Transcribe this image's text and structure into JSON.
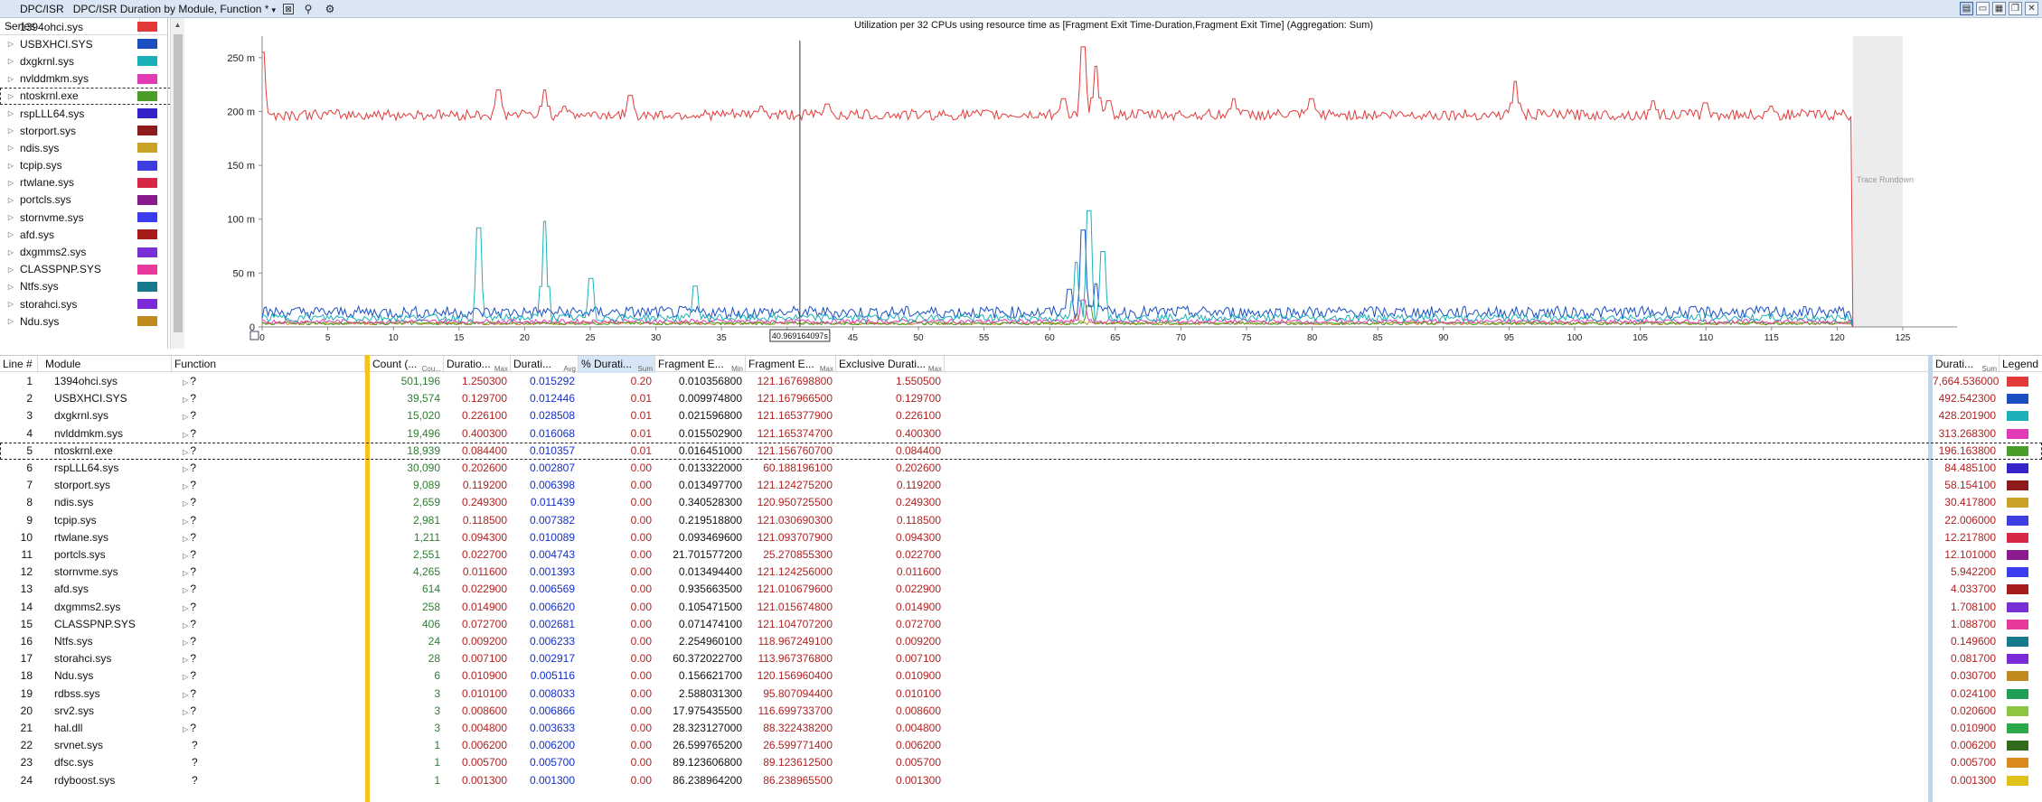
{
  "window": {
    "title_group": "DPC/ISR",
    "title_view": "DPC/ISR Duration by Module, Function *",
    "caret": "▾"
  },
  "series_panel": {
    "header": "Series",
    "items": [
      {
        "name": "1394ohci.sys",
        "color": "#e23a3a"
      },
      {
        "name": "USBXHCI.SYS",
        "color": "#1a4fc2"
      },
      {
        "name": "dxgkrnl.sys",
        "color": "#1bb0b8"
      },
      {
        "name": "nvlddmkm.sys",
        "color": "#e03bb5"
      },
      {
        "name": "ntoskrnl.exe",
        "color": "#4a9d26"
      },
      {
        "name": "rspLLL64.sys",
        "color": "#3224c8"
      },
      {
        "name": "storport.sys",
        "color": "#8e1a1a"
      },
      {
        "name": "ndis.sys",
        "color": "#c9a127"
      },
      {
        "name": "tcpip.sys",
        "color": "#3d3de0"
      },
      {
        "name": "rtwlane.sys",
        "color": "#d62745"
      },
      {
        "name": "portcls.sys",
        "color": "#8b1a8e"
      },
      {
        "name": "stornvme.sys",
        "color": "#3b3bf0"
      },
      {
        "name": "afd.sys",
        "color": "#a81b1b"
      },
      {
        "name": "dxgmms2.sys",
        "color": "#7a2fd6"
      },
      {
        "name": "CLASSPNP.SYS",
        "color": "#e8399c"
      },
      {
        "name": "Ntfs.sys",
        "color": "#147a8c"
      },
      {
        "name": "storahci.sys",
        "color": "#7b29d9"
      },
      {
        "name": "Ndu.sys",
        "color": "#c08a1e"
      }
    ]
  },
  "chart": {
    "title": "Utilization per 32 CPUs using resource time as [Fragment Exit Time-Duration,Fragment Exit Time] (Aggregation: Sum)",
    "cursor_label": "40.969164097s",
    "rundown_label": "Trace Rundown"
  },
  "chart_data": {
    "type": "line",
    "x_ticks": [
      "0",
      "5",
      "10",
      "15",
      "20",
      "25",
      "30",
      "35",
      "40",
      "45",
      "50",
      "55",
      "60",
      "65",
      "70",
      "75",
      "80",
      "85",
      "90",
      "95",
      "100",
      "105",
      "110",
      "115",
      "120",
      "125"
    ],
    "y_ticks": [
      "0",
      "50 m",
      "100 m",
      "150 m",
      "200 m",
      "250 m"
    ],
    "xlim": [
      0,
      125
    ],
    "ylim": [
      0,
      0.27
    ],
    "cursor_x": 40.969,
    "rundown_start_x": 121.2,
    "series": [
      {
        "name": "1394ohci.sys",
        "color": "#e23a3a",
        "baseline": 0.197,
        "spikes": [
          [
            0,
            0.255
          ],
          [
            18,
            0.22
          ],
          [
            21.5,
            0.22
          ],
          [
            23,
            0.205
          ],
          [
            28,
            0.215
          ],
          [
            38,
            0.205
          ],
          [
            43,
            0.207
          ],
          [
            61,
            0.212
          ],
          [
            62.5,
            0.26
          ],
          [
            63.5,
            0.242
          ],
          [
            64.5,
            0.21
          ],
          [
            74,
            0.212
          ],
          [
            80,
            0.212
          ],
          [
            95.5,
            0.228
          ],
          [
            106,
            0.21
          ],
          [
            110,
            0.208
          ],
          [
            115,
            0.205
          ]
        ]
      },
      {
        "name": "dxgkrnl.sys",
        "color": "#1bb0b8",
        "baseline": 0.005,
        "spikes": [
          [
            16.5,
            0.092
          ],
          [
            21.5,
            0.098
          ],
          [
            25,
            0.045
          ],
          [
            33,
            0.038
          ],
          [
            62,
            0.06
          ],
          [
            63,
            0.108
          ],
          [
            64,
            0.07
          ]
        ]
      },
      {
        "name": "USBXHCI.SYS",
        "color": "#1a4fc2",
        "baseline": 0.008,
        "spikes": [
          [
            61.5,
            0.035
          ],
          [
            62.5,
            0.09
          ],
          [
            63.5,
            0.04
          ]
        ]
      },
      {
        "name": "nvlddmkm.sys",
        "color": "#e03bb5",
        "baseline": 0.003,
        "spikes": [
          [
            62.5,
            0.025
          ]
        ]
      },
      {
        "name": "ntoskrnl.exe",
        "color": "#4a9d26",
        "baseline": 0.002,
        "spikes": [
          [
            63,
            0.02
          ]
        ]
      },
      {
        "name": "Ndu.sys",
        "color": "#c08a1e",
        "baseline": 0.002,
        "spikes": [
          [
            62,
            0.012
          ]
        ]
      }
    ]
  },
  "table": {
    "headers": {
      "line": "Line #",
      "module": "Module",
      "function": "Function",
      "count": "Count (...",
      "count_agg": "Cou...",
      "dur_max": "Duratio...",
      "dur_max_agg": "Max",
      "dur_avg": "Durati...",
      "dur_avg_agg": "Avg",
      "pct": "% Durati...",
      "pct_agg": "Sum",
      "fe_min": "Fragment E...",
      "fe_min_agg": "Min",
      "fe_max": "Fragment E...",
      "fe_max_agg": "Max",
      "excl": "Exclusive Durati...",
      "excl_agg": "Max",
      "dur_sum": "Durati...",
      "dur_sum_agg": "Sum",
      "legend": "Legend"
    },
    "rows": [
      {
        "line": "1",
        "module": "1394ohci.sys",
        "func": "?",
        "count": "501,196",
        "dmax": "1.250300",
        "davg": "0.015292",
        "pct": "0.20",
        "femin": "0.010356800",
        "femax": "121.167698800",
        "excl": "1.550500",
        "dsum": "7,664.536000",
        "color": "#e23a3a"
      },
      {
        "line": "2",
        "module": "USBXHCI.SYS",
        "func": "?",
        "count": "39,574",
        "dmax": "0.129700",
        "davg": "0.012446",
        "pct": "0.01",
        "femin": "0.009974800",
        "femax": "121.167966500",
        "excl": "0.129700",
        "dsum": "492.542300",
        "color": "#1a4fc2"
      },
      {
        "line": "3",
        "module": "dxgkrnl.sys",
        "func": "?",
        "count": "15,020",
        "dmax": "0.226100",
        "davg": "0.028508",
        "pct": "0.01",
        "femin": "0.021596800",
        "femax": "121.165377900",
        "excl": "0.226100",
        "dsum": "428.201900",
        "color": "#1bb0b8"
      },
      {
        "line": "4",
        "module": "nvlddmkm.sys",
        "func": "?",
        "count": "19,496",
        "dmax": "0.400300",
        "davg": "0.016068",
        "pct": "0.01",
        "femin": "0.015502900",
        "femax": "121.165374700",
        "excl": "0.400300",
        "dsum": "313.268300",
        "color": "#e03bb5"
      },
      {
        "line": "5",
        "module": "ntoskrnl.exe",
        "func": "?",
        "count": "18,939",
        "dmax": "0.084400",
        "davg": "0.010357",
        "pct": "0.01",
        "femin": "0.016451000",
        "femax": "121.156760700",
        "excl": "0.084400",
        "dsum": "196.163800",
        "color": "#4a9d26"
      },
      {
        "line": "6",
        "module": "rspLLL64.sys",
        "func": "?",
        "count": "30,090",
        "dmax": "0.202600",
        "davg": "0.002807",
        "pct": "0.00",
        "femin": "0.013322000",
        "femax": "60.188196100",
        "excl": "0.202600",
        "dsum": "84.485100",
        "color": "#3224c8"
      },
      {
        "line": "7",
        "module": "storport.sys",
        "func": "?",
        "count": "9,089",
        "dmax": "0.119200",
        "davg": "0.006398",
        "pct": "0.00",
        "femin": "0.013497700",
        "femax": "121.124275200",
        "excl": "0.119200",
        "dsum": "58.154100",
        "color": "#8e1a1a"
      },
      {
        "line": "8",
        "module": "ndis.sys",
        "func": "?",
        "count": "2,659",
        "dmax": "0.249300",
        "davg": "0.011439",
        "pct": "0.00",
        "femin": "0.340528300",
        "femax": "120.950725500",
        "excl": "0.249300",
        "dsum": "30.417800",
        "color": "#c9a127"
      },
      {
        "line": "9",
        "module": "tcpip.sys",
        "func": "?",
        "count": "2,981",
        "dmax": "0.118500",
        "davg": "0.007382",
        "pct": "0.00",
        "femin": "0.219518800",
        "femax": "121.030690300",
        "excl": "0.118500",
        "dsum": "22.006000",
        "color": "#3d3de0"
      },
      {
        "line": "10",
        "module": "rtwlane.sys",
        "func": "?",
        "count": "1,211",
        "dmax": "0.094300",
        "davg": "0.010089",
        "pct": "0.00",
        "femin": "0.093469600",
        "femax": "121.093707900",
        "excl": "0.094300",
        "dsum": "12.217800",
        "color": "#d62745"
      },
      {
        "line": "11",
        "module": "portcls.sys",
        "func": "?",
        "count": "2,551",
        "dmax": "0.022700",
        "davg": "0.004743",
        "pct": "0.00",
        "femin": "21.701577200",
        "femax": "25.270855300",
        "excl": "0.022700",
        "dsum": "12.101000",
        "color": "#8b1a8e"
      },
      {
        "line": "12",
        "module": "stornvme.sys",
        "func": "?",
        "count": "4,265",
        "dmax": "0.011600",
        "davg": "0.001393",
        "pct": "0.00",
        "femin": "0.013494400",
        "femax": "121.124256000",
        "excl": "0.011600",
        "dsum": "5.942200",
        "color": "#3b3bf0"
      },
      {
        "line": "13",
        "module": "afd.sys",
        "func": "?",
        "count": "614",
        "dmax": "0.022900",
        "davg": "0.006569",
        "pct": "0.00",
        "femin": "0.935663500",
        "femax": "121.010679600",
        "excl": "0.022900",
        "dsum": "4.033700",
        "color": "#a81b1b"
      },
      {
        "line": "14",
        "module": "dxgmms2.sys",
        "func": "?",
        "count": "258",
        "dmax": "0.014900",
        "davg": "0.006620",
        "pct": "0.00",
        "femin": "0.105471500",
        "femax": "121.015674800",
        "excl": "0.014900",
        "dsum": "1.708100",
        "color": "#7a2fd6"
      },
      {
        "line": "15",
        "module": "CLASSPNP.SYS",
        "func": "?",
        "count": "406",
        "dmax": "0.072700",
        "davg": "0.002681",
        "pct": "0.00",
        "femin": "0.071474100",
        "femax": "121.104707200",
        "excl": "0.072700",
        "dsum": "1.088700",
        "color": "#e8399c"
      },
      {
        "line": "16",
        "module": "Ntfs.sys",
        "func": "?",
        "count": "24",
        "dmax": "0.009200",
        "davg": "0.006233",
        "pct": "0.00",
        "femin": "2.254960100",
        "femax": "118.967249100",
        "excl": "0.009200",
        "dsum": "0.149600",
        "color": "#147a8c"
      },
      {
        "line": "17",
        "module": "storahci.sys",
        "func": "?",
        "count": "28",
        "dmax": "0.007100",
        "davg": "0.002917",
        "pct": "0.00",
        "femin": "60.372022700",
        "femax": "113.967376800",
        "excl": "0.007100",
        "dsum": "0.081700",
        "color": "#7b29d9"
      },
      {
        "line": "18",
        "module": "Ndu.sys",
        "func": "?",
        "count": "6",
        "dmax": "0.010900",
        "davg": "0.005116",
        "pct": "0.00",
        "femin": "0.156621700",
        "femax": "120.156960400",
        "excl": "0.010900",
        "dsum": "0.030700",
        "color": "#c08a1e"
      },
      {
        "line": "19",
        "module": "rdbss.sys",
        "func": "?",
        "count": "3",
        "dmax": "0.010100",
        "davg": "0.008033",
        "pct": "0.00",
        "femin": "2.588031300",
        "femax": "95.807094400",
        "excl": "0.010100",
        "dsum": "0.024100",
        "color": "#1f9e58"
      },
      {
        "line": "20",
        "module": "srv2.sys",
        "func": "?",
        "count": "3",
        "dmax": "0.008600",
        "davg": "0.006866",
        "pct": "0.00",
        "femin": "17.975435500",
        "femax": "116.699733700",
        "excl": "0.008600",
        "dsum": "0.020600",
        "color": "#8cc63f"
      },
      {
        "line": "21",
        "module": "hal.dll",
        "func": "?",
        "count": "3",
        "dmax": "0.004800",
        "davg": "0.003633",
        "pct": "0.00",
        "femin": "28.323127000",
        "femax": "88.322438200",
        "excl": "0.004800",
        "dsum": "0.010900",
        "color": "#2aa84a"
      },
      {
        "line": "22",
        "module": "srvnet.sys",
        "func": "?",
        "count": "1",
        "dmax": "0.006200",
        "davg": "0.006200",
        "pct": "0.00",
        "femin": "26.599765200",
        "femax": "26.599771400",
        "excl": "0.006200",
        "dsum": "0.006200",
        "color": "#2f6b1a"
      },
      {
        "line": "23",
        "module": "dfsc.sys",
        "func": "?",
        "count": "1",
        "dmax": "0.005700",
        "davg": "0.005700",
        "pct": "0.00",
        "femin": "89.123606800",
        "femax": "89.123612500",
        "excl": "0.005700",
        "dsum": "0.005700",
        "color": "#d98a1c"
      },
      {
        "line": "24",
        "module": "rdyboost.sys",
        "func": "?",
        "count": "1",
        "dmax": "0.001300",
        "davg": "0.001300",
        "pct": "0.00",
        "femin": "86.238964200",
        "femax": "86.238965500",
        "excl": "0.001300",
        "dsum": "0.001300",
        "color": "#e0c21a"
      }
    ]
  }
}
